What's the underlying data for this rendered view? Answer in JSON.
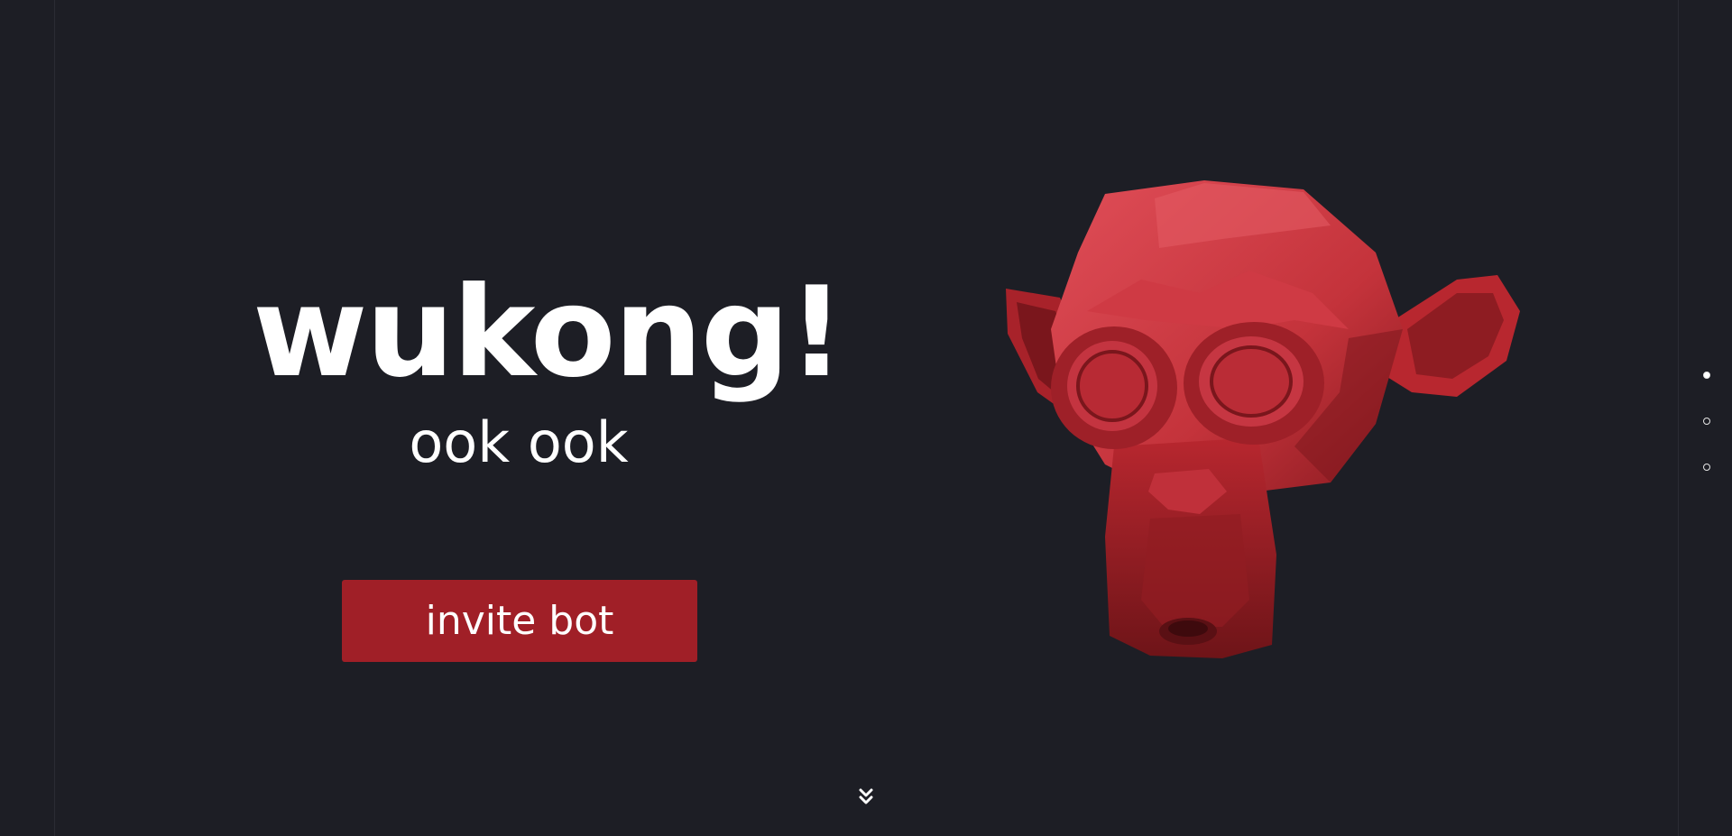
{
  "hero": {
    "title": "wukong!",
    "subtitle": "ook ook",
    "invite_label": "invite bot"
  },
  "mascot": {
    "icon": "monkey-head-icon",
    "color": "#b8272f"
  },
  "pagination": {
    "pages": [
      {
        "active": true
      },
      {
        "active": false
      },
      {
        "active": false
      }
    ]
  },
  "colors": {
    "background": "#1d1e25",
    "button": "#a01f27",
    "text": "#ffffff"
  },
  "scroll_icon": "double-chevron-down-icon"
}
